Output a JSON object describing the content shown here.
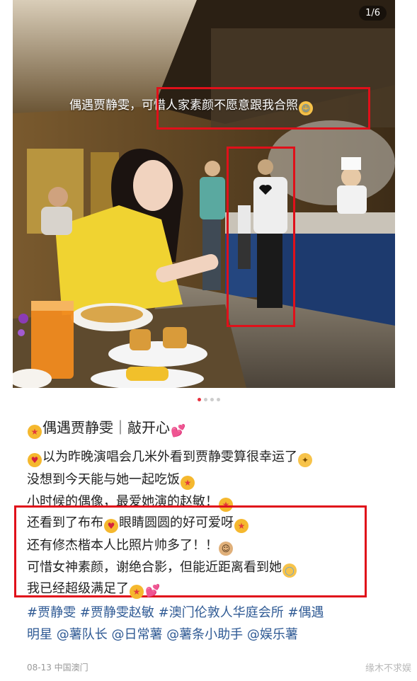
{
  "photo": {
    "counter": "1/6",
    "overlay_caption": "偶遇贾静雯，可惜人家素颜不愿意跟我合照",
    "overlay_emoji": "grinning-sweat-emoji"
  },
  "carousel": {
    "total": 4,
    "active": 0
  },
  "post": {
    "title": "偶遇贾静雯｜敲开心",
    "title_emoji_left": "star-struck-emoji",
    "title_emoji_right": "two-hearts-emoji",
    "lines": [
      {
        "pre_emoji": "heart-eyes-emoji",
        "text": "以为昨晚演唱会几米外看到贾静雯算很幸运了",
        "post_emoji": "party-face-emoji"
      },
      {
        "pre_emoji": "",
        "text": "没想到今天能与她一起吃饭",
        "post_emoji": "star-struck-emoji"
      },
      {
        "pre_emoji": "",
        "text": "小时候的偶像，最爱她演的赵敏！",
        "post_emoji": "star-struck-emoji"
      },
      {
        "pre_emoji": "",
        "text": "还看到了布布",
        "mid_emoji": "heart-eyes-emoji",
        "text2": "眼睛圆圆的好可爱呀",
        "post_emoji": "star-struck-emoji"
      },
      {
        "pre_emoji": "",
        "text": "还有修杰楷本人比照片帅多了！！",
        "post_emoji": "man-emoji"
      },
      {
        "pre_emoji": "",
        "text": "可惜女神素颜，谢绝合影，但能近距离看到她",
        "post_emoji": "halo-smile-emoji"
      },
      {
        "pre_emoji": "",
        "text": "我已经超级满足了",
        "post_emoji": "star-struck-emoji",
        "post_emoji2": "two-hearts-emoji"
      }
    ],
    "tags_line1": "#贾静雯 #贾静雯赵敏 #澳门伦敦人华庭会所 #偶遇",
    "tags_line2": "明星 @薯队长 @日常薯 @薯条小助手 @娱乐薯",
    "date_location": "08-13 中国澳门",
    "watermark": "缘木不求娱"
  },
  "colors": {
    "highlight_border": "#e0101a",
    "tag_blue": "#2f5a94",
    "active_dot": "#e8313f"
  }
}
